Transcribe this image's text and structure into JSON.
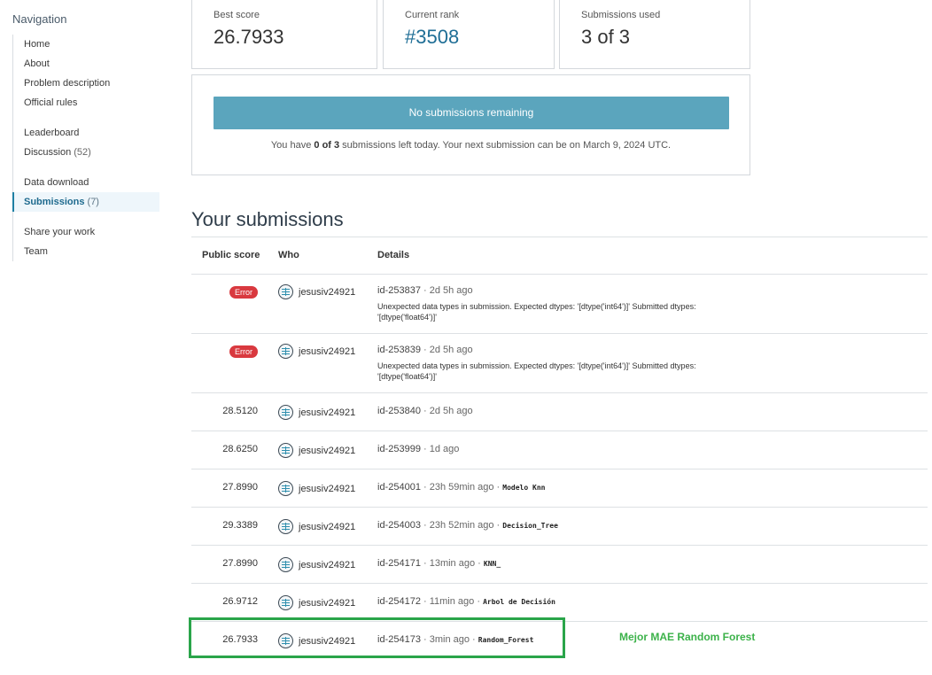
{
  "sidebar": {
    "title": "Navigation",
    "groups": [
      [
        {
          "label": "Home"
        },
        {
          "label": "About"
        },
        {
          "label": "Problem description"
        },
        {
          "label": "Official rules"
        }
      ],
      [
        {
          "label": "Leaderboard"
        },
        {
          "label": "Discussion",
          "count": "(52)"
        }
      ],
      [
        {
          "label": "Data download"
        },
        {
          "label": "Submissions",
          "count": "(7)"
        }
      ],
      [
        {
          "label": "Share your work"
        },
        {
          "label": "Team"
        }
      ]
    ]
  },
  "stats": {
    "best_score_label": "Best score",
    "best_score": "26.7933",
    "rank_label": "Current rank",
    "rank": "#3508",
    "used_label": "Submissions used",
    "used": "3 of 3"
  },
  "panel": {
    "button_label": "No submissions remaining",
    "note_pre": "You have ",
    "note_bold": "0 of 3",
    "note_post": " submissions left today. Your next submission can be on March 9, 2024 UTC."
  },
  "section_title": "Your submissions",
  "table": {
    "headers": {
      "score": "Public score",
      "who": "Who",
      "details": "Details"
    },
    "rows": [
      {
        "score": "",
        "status": "Error",
        "who": "jesusiv24921",
        "id": "id-253837",
        "ago": "· 2d 5h ago",
        "desc": "",
        "error": "Unexpected data types in submission. Expected dtypes: '[dtype('int64')]' Submitted dtypes: '[dtype('float64')]'"
      },
      {
        "score": "",
        "status": "Error",
        "who": "jesusiv24921",
        "id": "id-253839",
        "ago": "· 2d 5h ago",
        "desc": "",
        "error": "Unexpected data types in submission. Expected dtypes: '[dtype('int64')]' Submitted dtypes: '[dtype('float64')]'"
      },
      {
        "score": "28.5120",
        "status": "",
        "who": "jesusiv24921",
        "id": "id-253840",
        "ago": "· 2d 5h ago",
        "desc": "",
        "error": ""
      },
      {
        "score": "28.6250",
        "status": "",
        "who": "jesusiv24921",
        "id": "id-253999",
        "ago": "· 1d ago",
        "desc": "",
        "error": ""
      },
      {
        "score": "27.8990",
        "status": "",
        "who": "jesusiv24921",
        "id": "id-254001",
        "ago": "· 23h 59min ago ·",
        "desc": "Modelo Knn",
        "error": ""
      },
      {
        "score": "29.3389",
        "status": "",
        "who": "jesusiv24921",
        "id": "id-254003",
        "ago": "· 23h 52min ago ·",
        "desc": "Decision_Tree",
        "error": ""
      },
      {
        "score": "27.8990",
        "status": "",
        "who": "jesusiv24921",
        "id": "id-254171",
        "ago": "· 13min ago ·",
        "desc": "KNN_",
        "error": ""
      },
      {
        "score": "26.9712",
        "status": "",
        "who": "jesusiv24921",
        "id": "id-254172",
        "ago": "· 11min ago ·",
        "desc": "Arbol de Decisión",
        "error": ""
      },
      {
        "score": "26.7933",
        "status": "",
        "who": "jesusiv24921",
        "id": "id-254173",
        "ago": "· 3min ago ·",
        "desc": "Random_Forest",
        "error": ""
      }
    ]
  },
  "annotation": "Mejor MAE Random Forest",
  "colors": {
    "highlight": "#2aa54a",
    "error": "#d9393f",
    "button": "#5ba5bd"
  }
}
